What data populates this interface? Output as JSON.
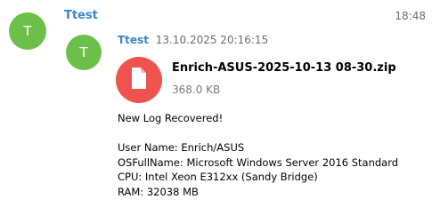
{
  "chat": {
    "name": "Ttest",
    "avatar_letter": "T",
    "time": "18:48"
  },
  "message": {
    "avatar_letter": "T",
    "sender": "Ttest",
    "datetime": "13.10.2025 20:16:15",
    "file": {
      "icon": "file-icon",
      "name": "Enrich-ASUS-2025-10-13 08-30.zip",
      "size": "368.0 KB"
    },
    "text_lines": [
      "New Log Recovered!",
      "",
      "User Name: Enrich/ASUS",
      "OSFullName: Microsoft Windows Server 2016 Standard",
      "CPU: Intel Xeon E312xx (Sandy Bridge)",
      "RAM: 32038 MB"
    ]
  },
  "colors": {
    "avatar": "#6cc04a",
    "name": "#3a86c8",
    "file_icon_bg": "#ef5350"
  }
}
